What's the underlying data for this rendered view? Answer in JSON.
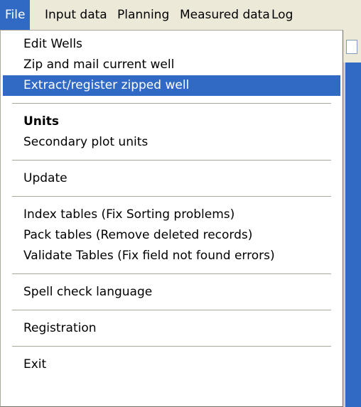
{
  "menubar": {
    "items": [
      {
        "label": "File"
      },
      {
        "label": "Input data"
      },
      {
        "label": "Planning"
      },
      {
        "label": "Measured data"
      },
      {
        "label": "Log"
      }
    ]
  },
  "file_menu": {
    "items": [
      {
        "label": "Edit Wells"
      },
      {
        "label": "Zip and mail current well"
      },
      {
        "label": "Extract/register zipped well"
      },
      {
        "label": "Units"
      },
      {
        "label": "Secondary plot units"
      },
      {
        "label": "Update"
      },
      {
        "label": "Index tables (Fix Sorting problems)"
      },
      {
        "label": "Pack tables (Remove deleted records)"
      },
      {
        "label": "Validate Tables (Fix field not found errors)"
      },
      {
        "label": "Spell check language"
      },
      {
        "label": "Registration"
      },
      {
        "label": "Exit"
      }
    ]
  },
  "colors": {
    "highlight": "#316ac5",
    "menu_background": "#ffffff",
    "menubar_background": "#ece9d8"
  }
}
